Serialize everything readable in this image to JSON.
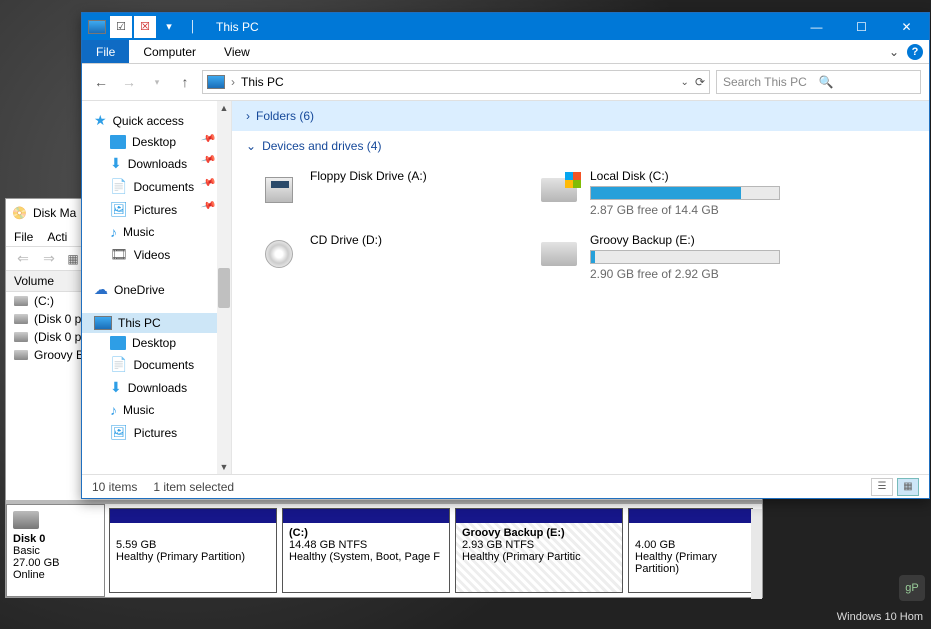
{
  "desktop": {
    "watermark": "Windows 10 Hom",
    "badge": "gP"
  },
  "diskMgmt": {
    "title": "Disk Ma",
    "menu": {
      "file": "File",
      "action": "Acti"
    },
    "volHeader": "Volume",
    "vols": [
      "(C:)",
      "(Disk 0 pa",
      "(Disk 0 pa",
      "Groovy B"
    ],
    "disk": {
      "iconLabel": "Disk 0",
      "basic": "Basic",
      "size": "27.00 GB",
      "status": "Online"
    },
    "parts": [
      {
        "title": "",
        "line1": "5.59 GB",
        "line2": "Healthy (Primary Partition)",
        "width": 168
      },
      {
        "title": "(C:)",
        "line1": "14.48 GB NTFS",
        "line2": "Healthy (System, Boot, Page F",
        "width": 168
      },
      {
        "title": "Groovy Backup  (E:)",
        "line1": "2.93 GB NTFS",
        "line2": "Healthy (Primary Partitic",
        "width": 168,
        "selected": true
      },
      {
        "title": "",
        "line1": "4.00 GB",
        "line2": "Healthy (Primary Partition)",
        "width": 125
      }
    ]
  },
  "explorer": {
    "title": "This PC",
    "ribbon": {
      "file": "File",
      "computer": "Computer",
      "view": "View"
    },
    "address": {
      "path": "This PC"
    },
    "search": {
      "placeholder": "Search This PC"
    },
    "nav": {
      "quick": "Quick access",
      "desktop": "Desktop",
      "downloads": "Downloads",
      "documents": "Documents",
      "pictures": "Pictures",
      "music": "Music",
      "videos": "Videos",
      "onedrive": "OneDrive",
      "thispc": "This PC",
      "pc_desktop": "Desktop",
      "pc_docs": "Documents",
      "pc_down": "Downloads",
      "pc_music": "Music",
      "pc_pics": "Pictures"
    },
    "groups": {
      "folders": "Folders (6)",
      "devices": "Devices and drives (4)"
    },
    "drives": {
      "floppy": "Floppy Disk Drive (A:)",
      "cd": "CD Drive (D:)",
      "localTitle": "Local Disk (C:)",
      "localSub": "2.87 GB free of 14.4 GB",
      "localPct": 80,
      "backupTitle": "Groovy Backup (E:)",
      "backupSub": "2.90 GB free of 2.92 GB",
      "backupPct": 2
    },
    "status": {
      "items": "10 items",
      "sel": "1 item selected"
    }
  }
}
